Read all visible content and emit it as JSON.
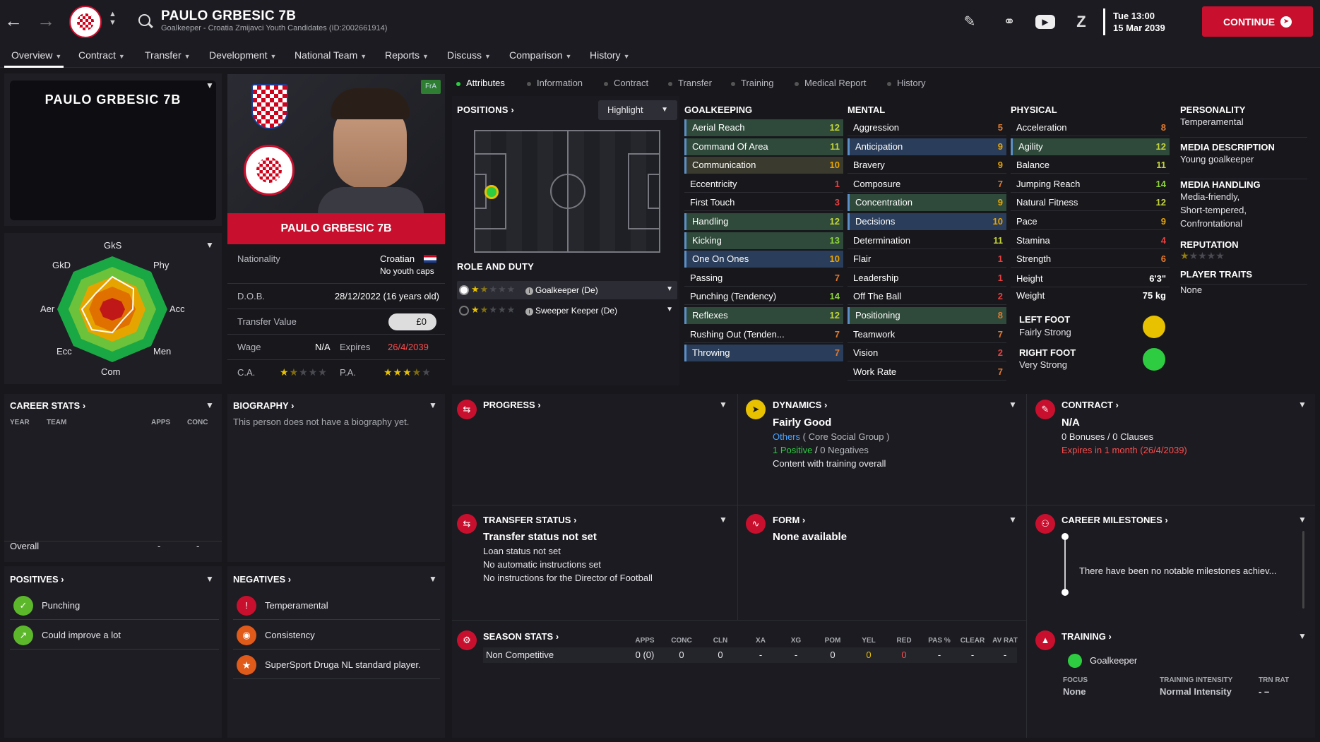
{
  "header": {
    "player_name": "PAULO GRBESIC 7B",
    "player_sub": "Goalkeeper - Croatia Zmijavci Youth Candidates (ID:2002661914)",
    "day_time": "Tue 13:00",
    "date": "15 Mar 2039",
    "continue_label": "CONTINUE"
  },
  "menu": [
    {
      "label": "Overview"
    },
    {
      "label": "Contract"
    },
    {
      "label": "Transfer"
    },
    {
      "label": "Development"
    },
    {
      "label": "National Team"
    },
    {
      "label": "Reports"
    },
    {
      "label": "Discuss"
    },
    {
      "label": "Comparison"
    },
    {
      "label": "History"
    }
  ],
  "name_card": {
    "title": "PAULO GRBESIC 7B"
  },
  "radar": {
    "labels": {
      "gks": "GkS",
      "gkd": "GkD",
      "phy": "Phy",
      "aer": "Aer",
      "acc": "Acc",
      "ecc": "Ecc",
      "men": "Men",
      "com": "Com"
    }
  },
  "profile": {
    "fra_badge": "FrA",
    "name": "PAULO GRBESIC 7B",
    "nationality_label": "Nationality",
    "nationality": "Croatian",
    "youth_caps": "No youth caps",
    "dob_label": "D.O.B.",
    "dob": "28/12/2022 (16 years old)",
    "transfer_value_label": "Transfer Value",
    "transfer_value": "£0",
    "wage_label": "Wage",
    "wage": "N/A",
    "expires_label": "Expires",
    "expires": "26/4/2039",
    "ca_label": "C.A.",
    "pa_label": "P.A.",
    "ca_stars": 1.5,
    "pa_stars": 3.5
  },
  "subtabs": [
    {
      "label": "Attributes"
    },
    {
      "label": "Information"
    },
    {
      "label": "Contract"
    },
    {
      "label": "Transfer"
    },
    {
      "label": "Training"
    },
    {
      "label": "Medical Report"
    },
    {
      "label": "History"
    }
  ],
  "positions": {
    "title": "POSITIONS",
    "highlight_label": "Highlight",
    "role_title": "ROLE AND DUTY",
    "roles": [
      {
        "label": "Goalkeeper (De)",
        "stars": 1.5
      },
      {
        "label": "Sweeper Keeper (De)",
        "stars": 1.5
      }
    ]
  },
  "goalkeeping": {
    "title": "GOALKEEPING",
    "items": [
      {
        "name": "Aerial Reach",
        "value": "12"
      },
      {
        "name": "Command Of Area",
        "value": "11"
      },
      {
        "name": "Communication",
        "value": "10"
      },
      {
        "name": "Eccentricity",
        "value": "1"
      },
      {
        "name": "First Touch",
        "value": "3"
      },
      {
        "name": "Handling",
        "value": "12"
      },
      {
        "name": "Kicking",
        "value": "13"
      },
      {
        "name": "One On Ones",
        "value": "10"
      },
      {
        "name": "Passing",
        "value": "7"
      },
      {
        "name": "Punching (Tendency)",
        "value": "14"
      },
      {
        "name": "Reflexes",
        "value": "12"
      },
      {
        "name": "Rushing Out (Tenden...",
        "value": "7"
      },
      {
        "name": "Throwing",
        "value": "7"
      }
    ]
  },
  "mental": {
    "title": "MENTAL",
    "items": [
      {
        "name": "Aggression",
        "value": "5"
      },
      {
        "name": "Anticipation",
        "value": "9"
      },
      {
        "name": "Bravery",
        "value": "9"
      },
      {
        "name": "Composure",
        "value": "7"
      },
      {
        "name": "Concentration",
        "value": "9"
      },
      {
        "name": "Decisions",
        "value": "10"
      },
      {
        "name": "Determination",
        "value": "11"
      },
      {
        "name": "Flair",
        "value": "1"
      },
      {
        "name": "Leadership",
        "value": "1"
      },
      {
        "name": "Off The Ball",
        "value": "2"
      },
      {
        "name": "Positioning",
        "value": "8"
      },
      {
        "name": "Teamwork",
        "value": "7"
      },
      {
        "name": "Vision",
        "value": "2"
      },
      {
        "name": "Work Rate",
        "value": "7"
      }
    ]
  },
  "physical": {
    "title": "PHYSICAL",
    "items": [
      {
        "name": "Acceleration",
        "value": "8"
      },
      {
        "name": "Agility",
        "value": "12"
      },
      {
        "name": "Balance",
        "value": "11"
      },
      {
        "name": "Jumping Reach",
        "value": "14"
      },
      {
        "name": "Natural Fitness",
        "value": "12"
      },
      {
        "name": "Pace",
        "value": "9"
      },
      {
        "name": "Stamina",
        "value": "4"
      },
      {
        "name": "Strength",
        "value": "6"
      }
    ],
    "height_label": "Height",
    "height": "6'3\"",
    "weight_label": "Weight",
    "weight": "75 kg",
    "left_foot_label": "LEFT FOOT",
    "left_foot": "Fairly Strong",
    "right_foot_label": "RIGHT FOOT",
    "right_foot": "Very Strong"
  },
  "personality": {
    "personality_label": "PERSONALITY",
    "personality": "Temperamental",
    "media_desc_label": "MEDIA DESCRIPTION",
    "media_desc": "Young goalkeeper",
    "media_handling_label": "MEDIA HANDLING",
    "media_handling_1": "Media-friendly,",
    "media_handling_2": "Short-tempered,",
    "media_handling_3": "Confrontational",
    "reputation_label": "REPUTATION",
    "reputation_stars": 0.5,
    "traits_label": "PLAYER TRAITS",
    "traits": "None"
  },
  "career": {
    "title": "CAREER STATS",
    "col_year": "YEAR",
    "col_team": "TEAM",
    "col_apps": "APPS",
    "col_conc": "CONC",
    "overall": "Overall",
    "overall_apps": "-",
    "overall_conc": "-"
  },
  "biography": {
    "title": "BIOGRAPHY",
    "text": "This person does not have a biography yet."
  },
  "positives": {
    "title": "POSITIVES",
    "items": [
      {
        "label": "Punching"
      },
      {
        "label": "Could improve a lot"
      }
    ]
  },
  "negatives": {
    "title": "NEGATIVES",
    "items": [
      {
        "label": "Temperamental"
      },
      {
        "label": "Consistency"
      },
      {
        "label": "SuperSport Druga NL standard player."
      }
    ]
  },
  "progress": {
    "title": "PROGRESS"
  },
  "dynamics": {
    "title": "DYNAMICS",
    "status": "Fairly Good",
    "group": "Others",
    "group_suffix": "( Core Social Group )",
    "positive": "1 Positive",
    "slash": "/",
    "negative": "0 Negatives",
    "note": "Content with training overall"
  },
  "contract": {
    "title": "CONTRACT",
    "status": "N/A",
    "clauses": "0 Bonuses / 0 Clauses",
    "expires": "Expires in 1 month (26/4/2039)"
  },
  "transfer_status": {
    "title": "TRANSFER STATUS",
    "status": "Transfer status not set",
    "l1": "Loan status not set",
    "l2": "No automatic instructions set",
    "l3": "No instructions for the Director of Football"
  },
  "form": {
    "title": "FORM",
    "status": "None available"
  },
  "milestones": {
    "title": "CAREER MILESTONES",
    "text": "There have been no notable milestones achiev..."
  },
  "season": {
    "title": "SEASON STATS",
    "cols": [
      "APPS",
      "CONC",
      "CLN",
      "XA",
      "XG",
      "POM",
      "YEL",
      "RED",
      "PAS %",
      "CLEAR",
      "AV RAT"
    ],
    "row_label": "Non Competitive",
    "values": [
      "0 (0)",
      "0",
      "0",
      "-",
      "-",
      "0",
      "0",
      "0",
      "-",
      "-",
      "-"
    ]
  },
  "training": {
    "title": "TRAINING",
    "role": "Goalkeeper",
    "focus_label": "FOCUS",
    "focus": "None",
    "intensity_label": "TRAINING INTENSITY",
    "intensity": "Normal Intensity",
    "trn_rat_label": "TRN RAT",
    "trn_rat": "- –"
  },
  "colors": {
    "accent": "#c8102e",
    "positive": "#2ecc40",
    "warning": "#e8c100"
  }
}
